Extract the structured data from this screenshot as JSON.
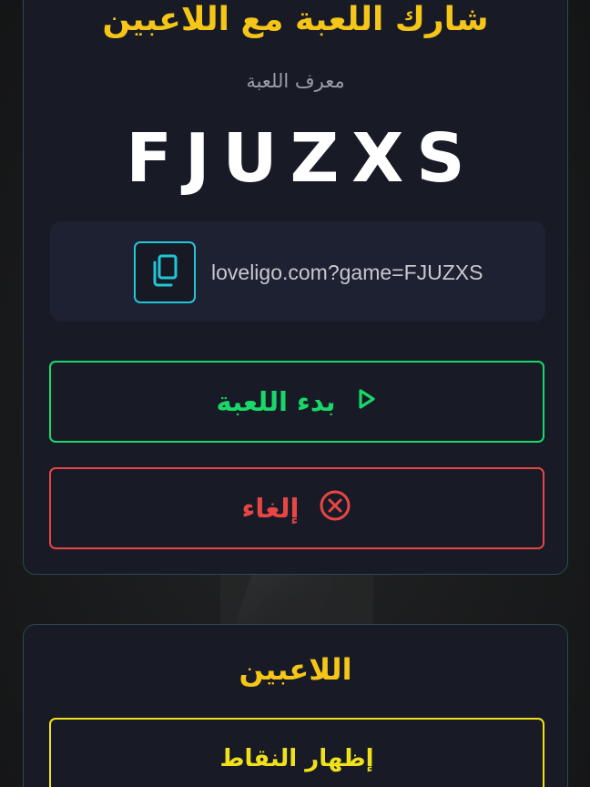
{
  "share": {
    "title": "شارك اللعبة مع اللاعبين",
    "id_label": "معرف اللعبة",
    "game_code": "FJUZXS",
    "link": "loveligo.com?game=FJUZXS"
  },
  "actions": {
    "start_label": "بدء اللعبة",
    "cancel_label": "إلغاء"
  },
  "players": {
    "title": "اللاعبين",
    "show_points_label": "إظهار النقاط"
  },
  "icons": {
    "copy": "copy-icon",
    "play": "play-icon",
    "cancel": "cancel-circle-x-icon"
  },
  "colors": {
    "title": "#f5c518",
    "start": "#19d86a",
    "cancel": "#e84545",
    "copy_accent": "#22c6d6",
    "show_points": "#f0e11a",
    "card_bg": "#181b26",
    "card_border": "#2c4a4f"
  }
}
